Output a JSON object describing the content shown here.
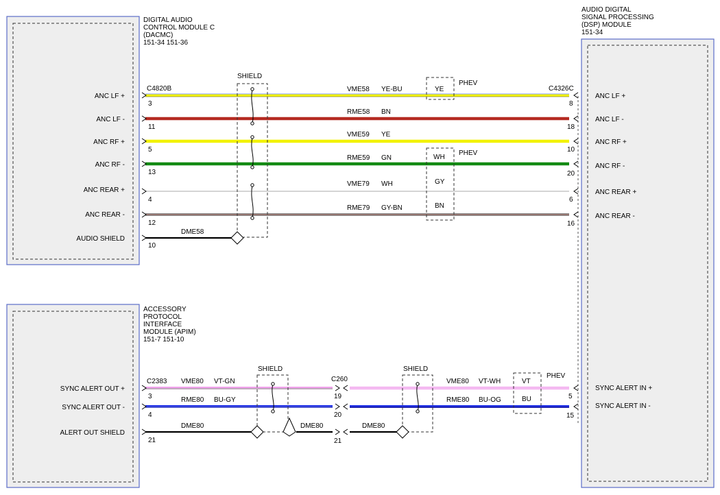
{
  "modules": {
    "dacmc": {
      "lines": [
        "DIGITAL AUDIO",
        "CONTROL MODULE C",
        "(DACMC)",
        "151-34  151-36"
      ],
      "connector": "C4820B",
      "pins": [
        {
          "label": "ANC LF +",
          "num": "3"
        },
        {
          "label": "ANC LF -",
          "num": "11"
        },
        {
          "label": "ANC RF +",
          "num": "5"
        },
        {
          "label": "ANC RF -",
          "num": "13"
        },
        {
          "label": "ANC REAR +",
          "num": "4"
        },
        {
          "label": "ANC REAR -",
          "num": "12"
        },
        {
          "label": "AUDIO SHIELD",
          "num": "10"
        }
      ]
    },
    "dsp": {
      "lines": [
        "AUDIO DIGITAL",
        "SIGNAL PROCESSING",
        "(DSP) MODULE",
        "151-34"
      ],
      "connector": "C4326C",
      "pins": [
        {
          "label": "ANC LF +",
          "num": "8"
        },
        {
          "label": "ANC LF -",
          "num": "18"
        },
        {
          "label": "ANC RF +",
          "num": "10"
        },
        {
          "label": "ANC RF -",
          "num": "20"
        },
        {
          "label": "ANC REAR +",
          "num": "6"
        },
        {
          "label": "ANC REAR -",
          "num": "16"
        },
        {
          "label": "SYNC ALERT IN +",
          "num": "5"
        },
        {
          "label": "SYNC ALERT IN -",
          "num": "15"
        }
      ]
    },
    "apim": {
      "lines": [
        "ACCESSORY",
        "PROTOCOL",
        "INTERFACE",
        "MODULE (APIM)",
        "151-7   151-10"
      ],
      "connector": "C2383",
      "pins": [
        {
          "label": "SYNC ALERT OUT +",
          "num": "3"
        },
        {
          "label": "SYNC ALERT OUT -",
          "num": "4"
        },
        {
          "label": "ALERT OUT SHIELD",
          "num": "21"
        }
      ]
    }
  },
  "inline_connector": {
    "name": "C260",
    "pins": [
      "19",
      "20",
      "21"
    ]
  },
  "shield_label": "SHIELD",
  "phev_label": "PHEV",
  "wires_upper": [
    {
      "circuit": "VME58",
      "color": "YE-BU",
      "fill": "#f2f200",
      "stripe": "#5c7cf0"
    },
    {
      "circuit": "RME58",
      "color": "BN",
      "fill": "#b52b22",
      "stripe": ""
    },
    {
      "circuit": "VME59",
      "color": "YE",
      "fill": "#f2f200",
      "stripe": ""
    },
    {
      "circuit": "RME59",
      "color": "GN",
      "fill": "#138a13",
      "stripe": ""
    },
    {
      "circuit": "VME79",
      "color": "WH",
      "fill": "#c8c8c8",
      "stripe": ""
    },
    {
      "circuit": "RME79",
      "color": "GY-BN",
      "fill": "#8e8e8e",
      "stripe": "#9a4a3a"
    },
    {
      "circuit": "DME58",
      "color": "",
      "fill": "#000000",
      "stripe": ""
    }
  ],
  "phev_upper": [
    "YE",
    "WH",
    "GY",
    "BN"
  ],
  "wires_lower_left": [
    {
      "circuit": "VME80",
      "color": "VT-GN",
      "fill": "#f0a0ec",
      "stripe": "#6fb86f"
    },
    {
      "circuit": "RME80",
      "color": "BU-GY",
      "fill": "#1e2ee8",
      "stripe": "#9a9a9a"
    },
    {
      "circuit": "DME80",
      "color": "",
      "fill": "#000000",
      "stripe": ""
    }
  ],
  "drain_label_mid": "DME80",
  "wires_lower_right": [
    {
      "circuit": "VME80",
      "color": "VT-WH",
      "fill": "#f0a0ec",
      "stripe": "#ffffff"
    },
    {
      "circuit": "RME80",
      "color": "BU-OG",
      "fill": "#1e2ee8",
      "stripe": "#e88a2a"
    },
    {
      "circuit": "DME80",
      "color": "",
      "fill": "#000000",
      "stripe": ""
    }
  ],
  "phev_lower": [
    "VT",
    "BU"
  ]
}
